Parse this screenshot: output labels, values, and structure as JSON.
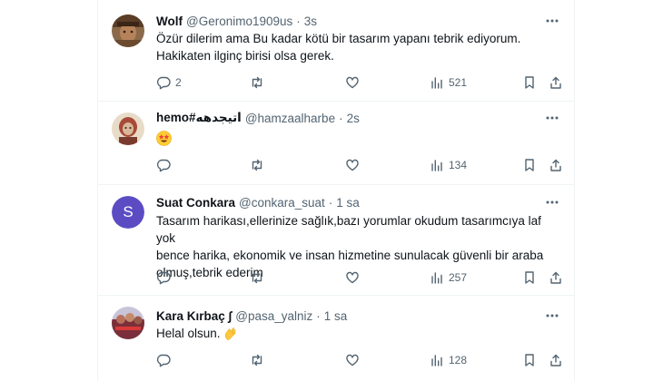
{
  "tweets": [
    {
      "name": "Wolf",
      "handle": "@Geronimo1909us",
      "dot": "·",
      "time": "3s",
      "text_lines": [
        "Özür dilerim ama Bu kadar kötü bir tasarım yapanı tebrik ediyorum.",
        "Hakikaten ilginç birisi olsa gerek."
      ],
      "replies": "2",
      "retweets": "",
      "likes": "",
      "views": "521"
    },
    {
      "name": "hemo#اتيجدهه",
      "handle": "@hamzaalharbe",
      "dot": "·",
      "time": "2s",
      "text_lines": [
        ""
      ],
      "emoji": "star-struck-emoji",
      "replies": "",
      "retweets": "",
      "likes": "",
      "views": "134"
    },
    {
      "name": "Suat Conkara",
      "handle": "@conkara_suat",
      "dot": "·",
      "time": "1 sa",
      "avatar_letter": "S",
      "avatar_color": "#5b4cc4",
      "text_lines": [
        "Tasarım harikası,ellerinize sağlık,bazı yorumlar okudum tasarımcıya laf yok",
        "bence harika, ekonomik ve insan hizmetine sunulacak güvenli bir araba",
        "olmuş,tebrik ederim"
      ],
      "replies": "",
      "retweets": "",
      "likes": "",
      "views": "257"
    },
    {
      "name": "Kara Kırbaç ∫",
      "handle": "@pasa_yalniz",
      "dot": "·",
      "time": "1 sa",
      "text_lines": [
        "Helal olsun."
      ],
      "emoji": "clapping-hands-emoji",
      "replies": "",
      "retweets": "",
      "likes": "",
      "views": "128"
    }
  ],
  "icons": {
    "reply": "reply-icon",
    "retweet": "retweet-icon",
    "like": "heart-icon",
    "views": "views-chart-icon",
    "bookmark": "bookmark-icon",
    "share": "share-icon",
    "more": "more-dots-icon"
  },
  "colors": {
    "text": "#0f1419",
    "secondary": "#536471",
    "divider": "#eff3f4"
  }
}
